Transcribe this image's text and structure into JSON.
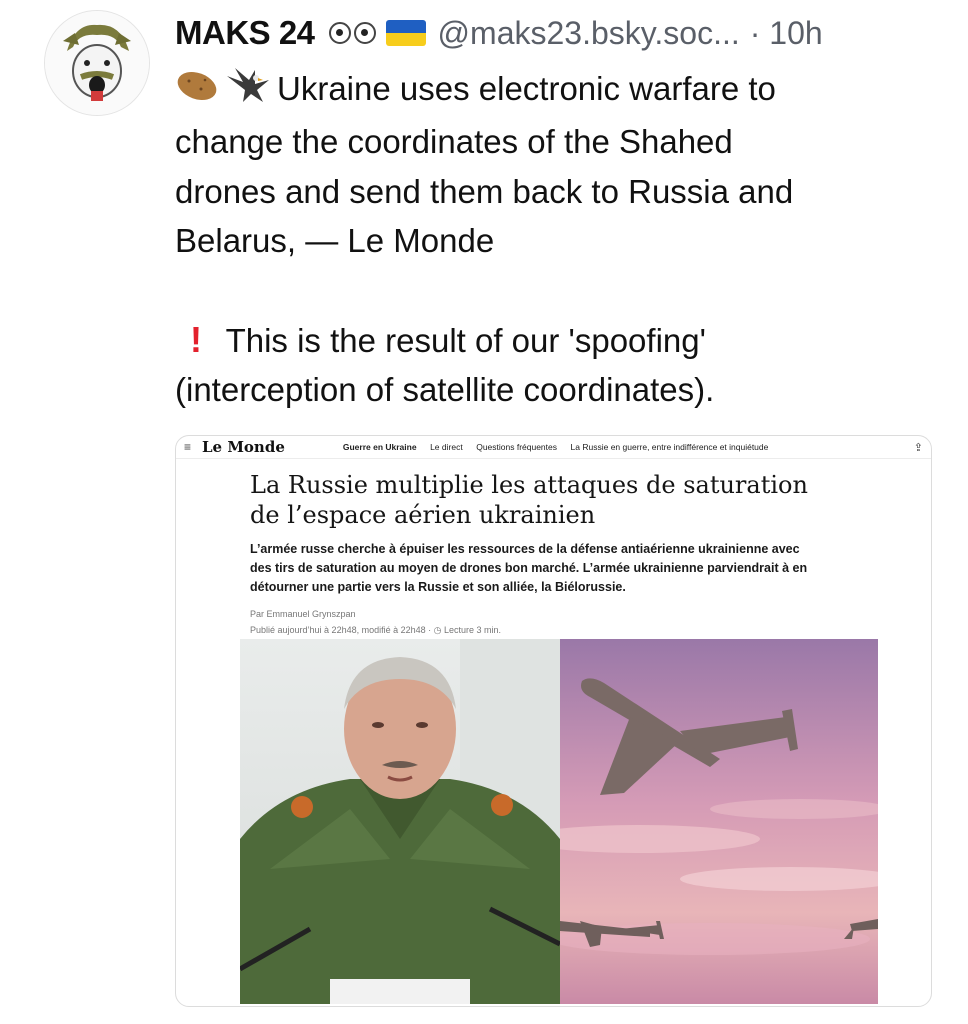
{
  "post": {
    "author_name": "MAKS 24",
    "handle": "@maks23.bsky.soc...",
    "time": "· 10h",
    "line1": "Ukraine uses electronic warfare to",
    "line2": "change the coordinates of the Shahed",
    "line3": "drones and send them back to Russia and",
    "line4": "Belarus, — Le Monde",
    "line5": "This is the result of our 'spoofing'",
    "line6": "(interception of satellite coordinates).",
    "exclamation": "!"
  },
  "article_card": {
    "logo": "Le Monde",
    "nav": [
      "Guerre en Ukraine",
      "Le direct",
      "Questions fréquentes",
      "La Russie en guerre, entre indifférence et inquiétude"
    ],
    "headline_line1": "La Russie multiplie les attaques de saturation",
    "headline_line2": "de l’espace aérien ukrainien",
    "deck": "L’armée russe cherche à épuiser les ressources de la défense antiaérienne ukrainienne avec des tirs de saturation au moyen de drones bon marché. L’armée ukrainienne parviendrait à en détourner une partie vers la Russie et son alliée, la Biélorussie.",
    "byline": "Par Emmanuel Grynszpan",
    "published": "Publié aujourd’hui à 22h48, modifié à 22h48",
    "reading_time": "Lecture 3 min."
  },
  "icons": {
    "eyes": "eyes-emoji-icon",
    "flag": "ukraine-flag-icon",
    "potato": "potato-emoji-icon",
    "eagle": "eagle-emoji-icon",
    "exclamation": "red-exclamation-icon",
    "menu": "hamburger-menu-icon",
    "share": "share-icon"
  },
  "colors": {
    "flag_blue": "#1f5fc2",
    "flag_yellow": "#f7cd1c",
    "exclamation": "#e3212d",
    "handle_gray": "#5a5f68"
  }
}
